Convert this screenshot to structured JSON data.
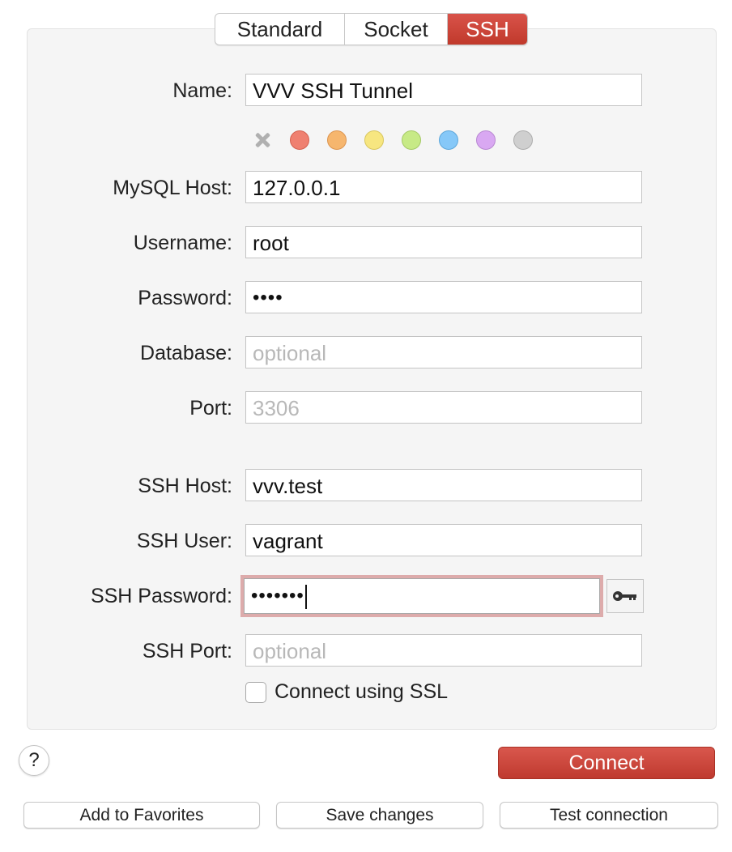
{
  "tabs": [
    {
      "label": "Standard",
      "active": false
    },
    {
      "label": "Socket",
      "active": false
    },
    {
      "label": "SSH",
      "active": true
    }
  ],
  "form": {
    "name": {
      "label": "Name:",
      "value": "VVV SSH Tunnel"
    },
    "colors": [
      "#ef8070",
      "#f6b66e",
      "#f7e680",
      "#c7ea86",
      "#86c8f8",
      "#d9a8f2",
      "#cfcfcf"
    ],
    "mysql_host": {
      "label": "MySQL Host:",
      "value": "127.0.0.1"
    },
    "username": {
      "label": "Username:",
      "value": "root"
    },
    "password": {
      "label": "Password:",
      "value": "••••"
    },
    "database": {
      "label": "Database:",
      "placeholder": "optional"
    },
    "port": {
      "label": "Port:",
      "placeholder": "3306"
    },
    "ssh_host": {
      "label": "SSH Host:",
      "value": "vvv.test"
    },
    "ssh_user": {
      "label": "SSH User:",
      "value": "vagrant"
    },
    "ssh_password": {
      "label": "SSH Password:",
      "value": "•••••••"
    },
    "ssh_port": {
      "label": "SSH Port:",
      "placeholder": "optional"
    },
    "ssl": {
      "label": "Connect using SSL",
      "checked": false
    }
  },
  "buttons": {
    "help": "?",
    "connect": "Connect",
    "add_favorites": "Add to Favorites",
    "save_changes": "Save changes",
    "test_connection": "Test connection"
  },
  "icons": {
    "clear_color": "x-icon",
    "ssh_key": "key-icon",
    "help": "question-icon"
  }
}
